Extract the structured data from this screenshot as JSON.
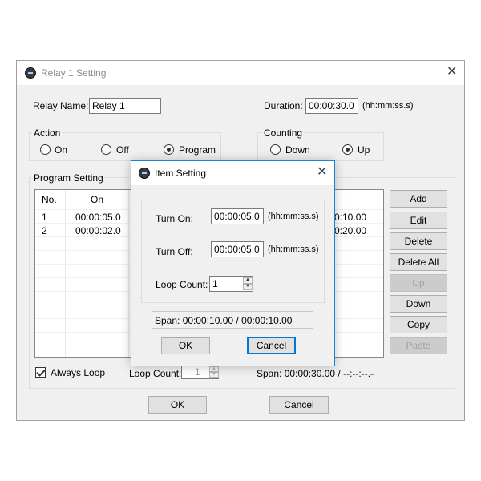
{
  "main_window": {
    "title": "Relay 1 Setting",
    "relay_name_label": "Relay Name:",
    "relay_name_value": "Relay 1",
    "duration_label": "Duration:",
    "duration_value": "00:00:30.0",
    "duration_unit": "(hh:mm:ss.s)",
    "action": {
      "label": "Action",
      "options": [
        "On",
        "Off",
        "Program"
      ],
      "selected": "Program"
    },
    "counting": {
      "label": "Counting",
      "options": [
        "Down",
        "Up"
      ],
      "selected": "Up"
    },
    "program_setting": {
      "label": "Program Setting",
      "columns": [
        "No.",
        "On"
      ],
      "rows": [
        {
          "no": "1",
          "on": "00:00:05.0",
          "off_partial": "0:10.00"
        },
        {
          "no": "2",
          "on": "00:00:02.0",
          "off_partial": "0:20.00"
        }
      ],
      "side_buttons": [
        {
          "label": "Add",
          "enabled": true
        },
        {
          "label": "Edit",
          "enabled": true
        },
        {
          "label": "Delete",
          "enabled": true
        },
        {
          "label": "Delete All",
          "enabled": true
        },
        {
          "label": "Up",
          "enabled": false
        },
        {
          "label": "Down",
          "enabled": true
        },
        {
          "label": "Copy",
          "enabled": true
        },
        {
          "label": "Paste",
          "enabled": false
        }
      ],
      "always_loop_label": "Always Loop",
      "always_loop_checked": true,
      "loop_count_label": "Loop Count:",
      "loop_count_value": "1",
      "span_text": "Span: 00:00:30.00 / --:--:--.-"
    },
    "ok_label": "OK",
    "cancel_label": "Cancel"
  },
  "item_dialog": {
    "title": "Item Setting",
    "turn_on_label": "Turn On:",
    "turn_on_value": "00:00:05.0",
    "turn_off_label": "Turn Off:",
    "turn_off_value": "00:00:05.0",
    "unit": "(hh:mm:ss.s)",
    "loop_count_label": "Loop Count:",
    "loop_count_value": "1",
    "span_text": "Span: 00:00:10.00 / 00:00:10.00",
    "ok_label": "OK",
    "cancel_label": "Cancel"
  },
  "icons": {
    "app": "relay-app-icon",
    "close": "close-icon",
    "spin_up": "spin-up-icon",
    "spin_down": "spin-down-icon"
  },
  "colors": {
    "accent": "#0078d7",
    "window_bg": "#f0f0f0"
  }
}
